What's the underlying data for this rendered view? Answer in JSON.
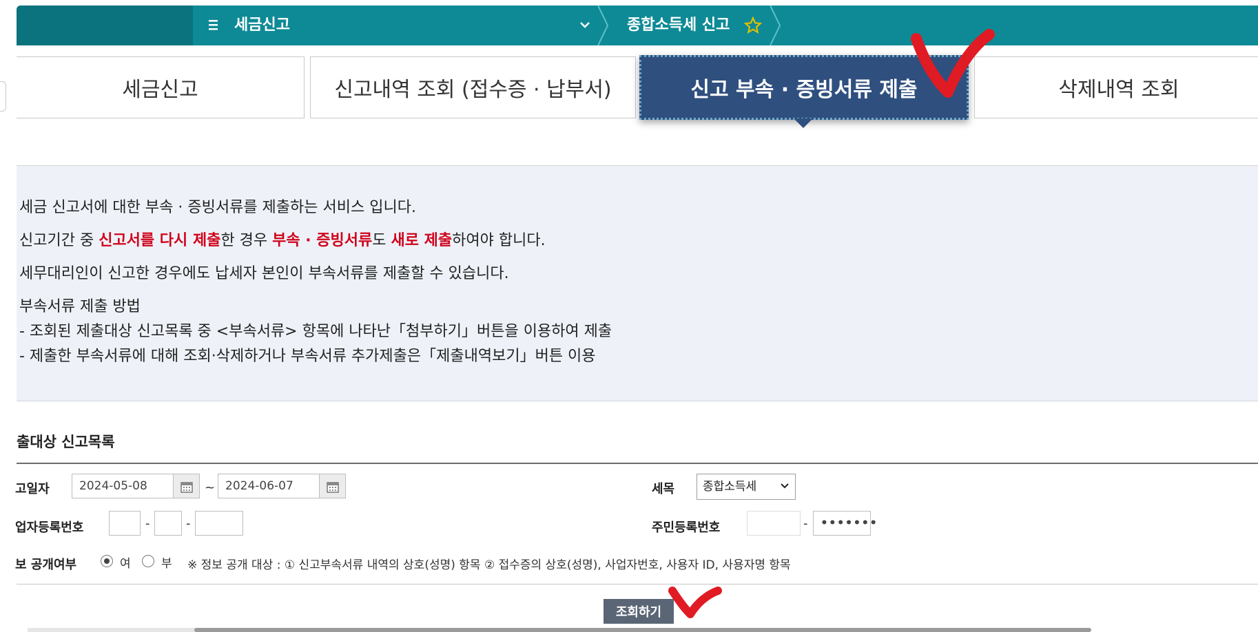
{
  "topbar": {
    "menu_title": "세금신고",
    "breadcrumb": "종합소득세 신고"
  },
  "tabs": [
    {
      "label": "세금신고"
    },
    {
      "label": "신고내역 조회 (접수증 · 납부서)"
    },
    {
      "label": "신고 부속 · 증빙서류 제출",
      "active": true
    },
    {
      "label": "삭제내역 조회"
    }
  ],
  "info": {
    "line1": "세금 신고서에 대한 부속 · 증빙서류를 제출하는 서비스 입니다.",
    "line2": {
      "p1": "신고기간 중 ",
      "h1": "신고서를 다시 제출",
      "p2": "한 경우 ",
      "h2": "부속 · 증빙서류",
      "p3": "도 ",
      "h3": "새로 제출",
      "p4": "하여야 합니다."
    },
    "line3": "세무대리인이 신고한 경우에도 납세자 본인이 부속서류를 제출할 수 있습니다.",
    "method_title": "부속서류 제출 방법",
    "method_1": "- 조회된 제출대상 신고목록 중 <부속서류> 항목에 나타난「첨부하기」버튼을 이용하여 제출",
    "method_2": "- 제출한 부속서류에 대해 조회·삭제하거나 부속서류 추가제출은「제출내역보기」버튼 이용"
  },
  "search": {
    "section_title": "출대상 신고목록",
    "date_label": "고일자",
    "date_from": "2024-05-08",
    "date_to": "2024-06-07",
    "tilde": "~",
    "tax_item_label": "세목",
    "tax_item_value": "종합소득세",
    "biz_no_label": "업자등록번호",
    "rrn_label": "주민등록번호",
    "rrn_back": "•••••••",
    "dash": "-",
    "disclosure_label": "보 공개여부",
    "radio_yes": "여",
    "radio_no": "부",
    "radio_selected": "여",
    "disclosure_note": "※ 정보 공개 대상 : ① 신고부속서류 내역의 상호(성명) 항목 ② 접수증의 상호(성명), 사업자번호, 사용자 ID, 사용자명 항목",
    "search_button": "조회하기"
  },
  "colors": {
    "topbar": "#0e8a96",
    "topbar_dark": "#0a737e",
    "active_tab": "#2f4f7f",
    "highlight_red": "#d0021b",
    "annotation_red": "#e01b24",
    "star": "#e2c200",
    "info_bg": "#eef2f8",
    "search_button": "#5a6675"
  },
  "icons": [
    "menu-icon",
    "chevron-down-icon",
    "star-icon",
    "calendar-icon",
    "checkmark-annotation"
  ]
}
